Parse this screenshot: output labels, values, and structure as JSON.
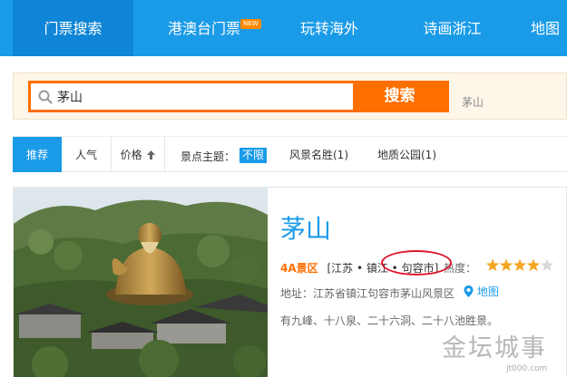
{
  "nav": {
    "tabs": [
      {
        "label": "门票搜索"
      },
      {
        "label": "港澳台门票"
      },
      {
        "label": "玩转海外"
      },
      {
        "label": "诗画浙江"
      },
      {
        "label": "地图"
      }
    ],
    "active_index": 0,
    "new_badge": "NEW"
  },
  "search": {
    "value": "茅山",
    "button_label": "搜索",
    "hint": "茅山"
  },
  "filters": {
    "sorts": [
      {
        "label": "推荐"
      },
      {
        "label": "人气"
      },
      {
        "label": "价格"
      }
    ],
    "active_sort": 0,
    "theme_label": "景点主题：",
    "themes": [
      {
        "label": "不限"
      },
      {
        "label": "风景名胜(1)"
      },
      {
        "label": "地质公园(1)"
      }
    ],
    "active_theme": 0
  },
  "result": {
    "title": "茅山",
    "grade": "4A景区",
    "location": "[江苏 • 镇江 • 句容市]",
    "rating_label": "热度：",
    "rating": 4,
    "rating_max": 5,
    "address": "地址：江苏省镇江句容市茅山风景区",
    "map_label": "地图",
    "description": "有九峰、十八泉、二十六洞、二十八池胜景。"
  },
  "watermark": {
    "text": "金坛城事",
    "url": "jt000.com"
  },
  "colors": {
    "primary": "#1a9be8",
    "accent": "#ff6f00",
    "highlight": "#e0152b",
    "star": "#f5a623"
  }
}
